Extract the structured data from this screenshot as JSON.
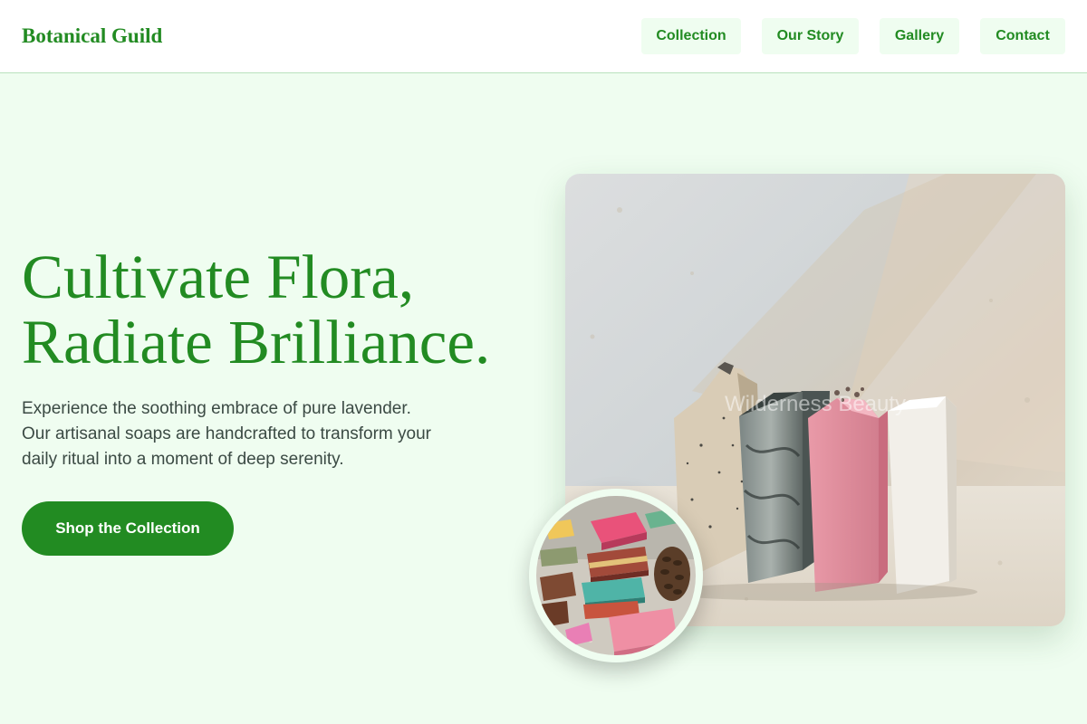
{
  "header": {
    "brand": "Botanical Guild",
    "nav": [
      {
        "label": "Collection"
      },
      {
        "label": "Our Story"
      },
      {
        "label": "Gallery"
      },
      {
        "label": "Contact"
      }
    ]
  },
  "hero": {
    "title_lines": [
      "Cultivate Flora,",
      "Radiate Brilliance."
    ],
    "description_lines": [
      "Experience the soothing embrace of pure lavender.",
      "Our artisanal soaps are handcrafted to transform your",
      "daily ritual into a moment of deep serenity."
    ],
    "cta_label": "Shop the Collection"
  },
  "images": {
    "main_watermark": "Wilderness Beauty",
    "main_alt": "Four handmade soap bars standing on stone",
    "circle_alt": "Assorted colorful soap bars"
  },
  "colors": {
    "brand_green": "#228b22",
    "page_background": "#effdf0",
    "header_background": "#ffffff",
    "body_text": "#3b4a44"
  }
}
